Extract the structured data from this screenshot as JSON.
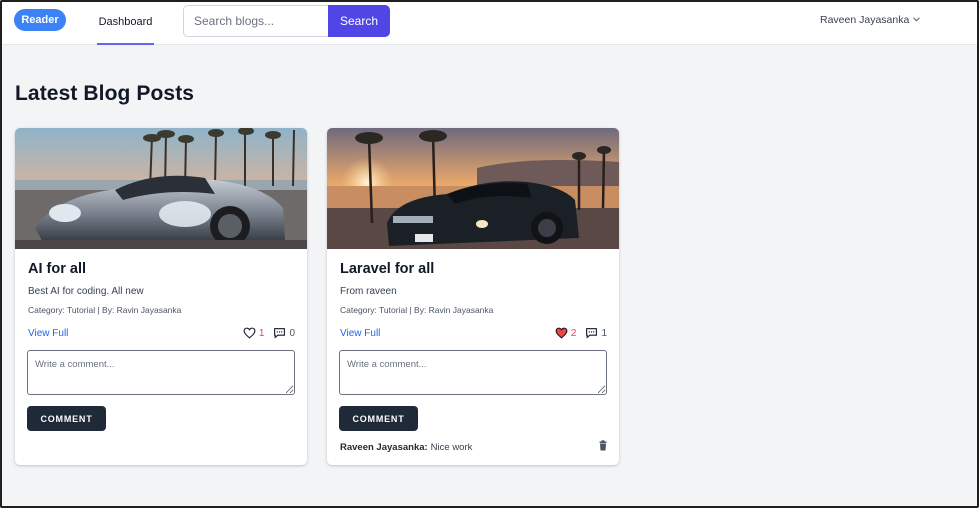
{
  "nav": {
    "logo": "Reader",
    "links": [
      {
        "label": "Dashboard"
      }
    ],
    "search": {
      "placeholder": "Search blogs...",
      "value": "",
      "button": "Search"
    },
    "user": {
      "name": "Raveen Jayasanka",
      "icon": "chevron-down-icon"
    }
  },
  "page": {
    "title": "Latest Blog Posts"
  },
  "posts": [
    {
      "title": "AI for all",
      "description": "Best AI for coding. All new",
      "meta": "Category: Tutorial | By: Ravin Jayasanka",
      "view_label": "View Full",
      "likes": "1",
      "liked": false,
      "comments": "0",
      "comment_placeholder": "Write a comment...",
      "comment_button": "COMMENT",
      "image": "silver-sports-car-photo"
    },
    {
      "title": "Laravel for all",
      "description": "From raveen",
      "meta": "Category: Tutorial | By: Ravin Jayasanka",
      "view_label": "View Full",
      "likes": "2",
      "liked": true,
      "comments": "1",
      "comment_placeholder": "Write a comment...",
      "comment_button": "COMMENT",
      "image": "black-muscle-car-sunset-photo",
      "comment_list": [
        {
          "author": "Raveen Jayasanka:",
          "text": "Nice work"
        }
      ]
    }
  ],
  "colors": {
    "accent": "#4f46e5",
    "logo": "#3b82f6",
    "link": "#2563eb",
    "like": "#ef4444",
    "button_dark": "#1f2937"
  }
}
